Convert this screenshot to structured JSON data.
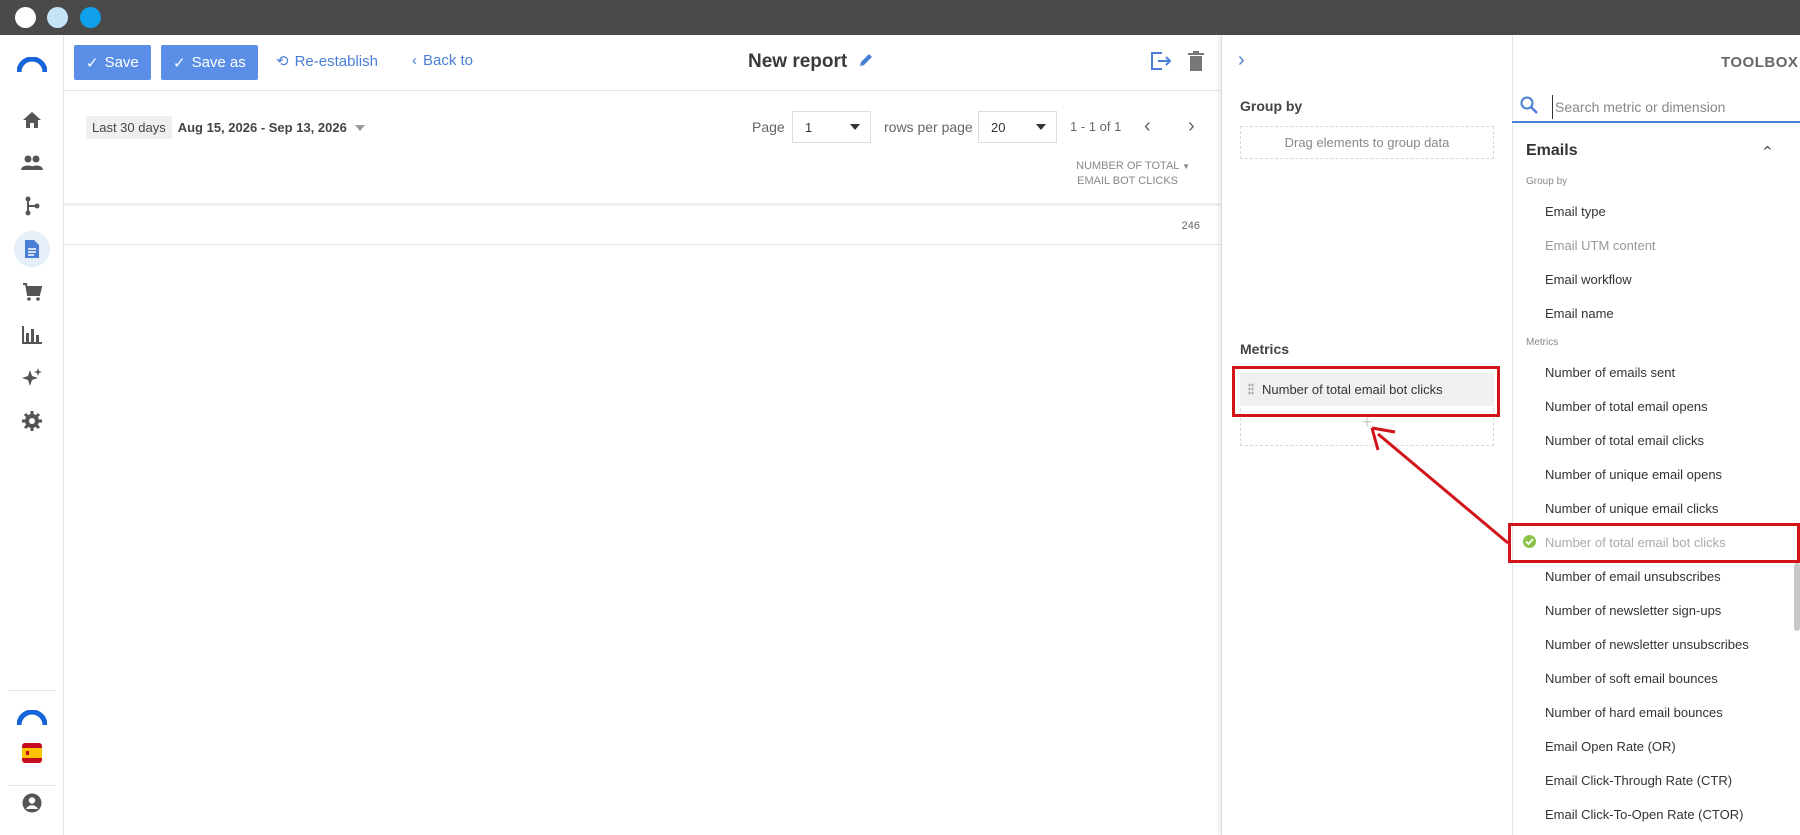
{
  "header": {
    "save_label": "Save",
    "save_as_label": "Save as",
    "reestablish_label": "Re-establish",
    "back_label": "Back to",
    "report_title": "New report"
  },
  "filters": {
    "date_preset": "Last 30 days",
    "date_range": "Aug 15, 2026 - Sep 13, 2026",
    "page_label": "Page",
    "page_value": "1",
    "rows_label": "rows per page",
    "rows_value": "20",
    "range_info": "1 - 1 of 1"
  },
  "table": {
    "column_header_line1": "NUMBER OF TOTAL",
    "column_header_line2": "EMAIL BOT CLICKS",
    "rows": [
      {
        "value": "246"
      }
    ]
  },
  "config": {
    "group_by_title": "Group by",
    "group_by_placeholder": "Drag elements to group data",
    "metrics_title": "Metrics",
    "metrics": [
      "Number of total email bot clicks"
    ]
  },
  "toolbox": {
    "title": "TOOLBOX",
    "search_placeholder": "Search metric or dimension",
    "category": "Emails",
    "group_by_label": "Group by",
    "group_by_items": [
      {
        "label": "Email type",
        "state": "normal"
      },
      {
        "label": "Email UTM content",
        "state": "dim"
      },
      {
        "label": "Email workflow",
        "state": "normal"
      },
      {
        "label": "Email name",
        "state": "normal"
      }
    ],
    "metrics_label": "Metrics",
    "metric_items": [
      {
        "label": "Number of emails sent",
        "state": "normal"
      },
      {
        "label": "Number of total email opens",
        "state": "normal"
      },
      {
        "label": "Number of total email clicks",
        "state": "normal"
      },
      {
        "label": "Number of unique email opens",
        "state": "normal"
      },
      {
        "label": "Number of unique email clicks",
        "state": "normal"
      },
      {
        "label": "Number of total email bot clicks",
        "state": "checked"
      },
      {
        "label": "Number of email unsubscribes",
        "state": "normal"
      },
      {
        "label": "Number of newsletter sign-ups",
        "state": "normal"
      },
      {
        "label": "Number of newsletter unsubscribes",
        "state": "normal"
      },
      {
        "label": "Number of soft email bounces",
        "state": "normal"
      },
      {
        "label": "Number of hard email bounces",
        "state": "normal"
      },
      {
        "label": "Email Open Rate (OR)",
        "state": "normal"
      },
      {
        "label": "Email Click-Through Rate (CTR)",
        "state": "normal"
      },
      {
        "label": "Email Click-To-Open Rate (CTOR)",
        "state": "normal"
      }
    ]
  },
  "colors": {
    "accent": "#5b8ee6",
    "link": "#4a7fd6",
    "highlight": "#d1141a",
    "check": "#8bc34a"
  },
  "sidebar_icons": [
    "logo-icon",
    "home-icon",
    "users-icon",
    "workflow-icon",
    "reports-icon",
    "cart-icon",
    "analytics-icon",
    "ai-sparkle-icon",
    "settings-icon",
    "brand-icon",
    "spain-flag-icon",
    "account-icon"
  ]
}
